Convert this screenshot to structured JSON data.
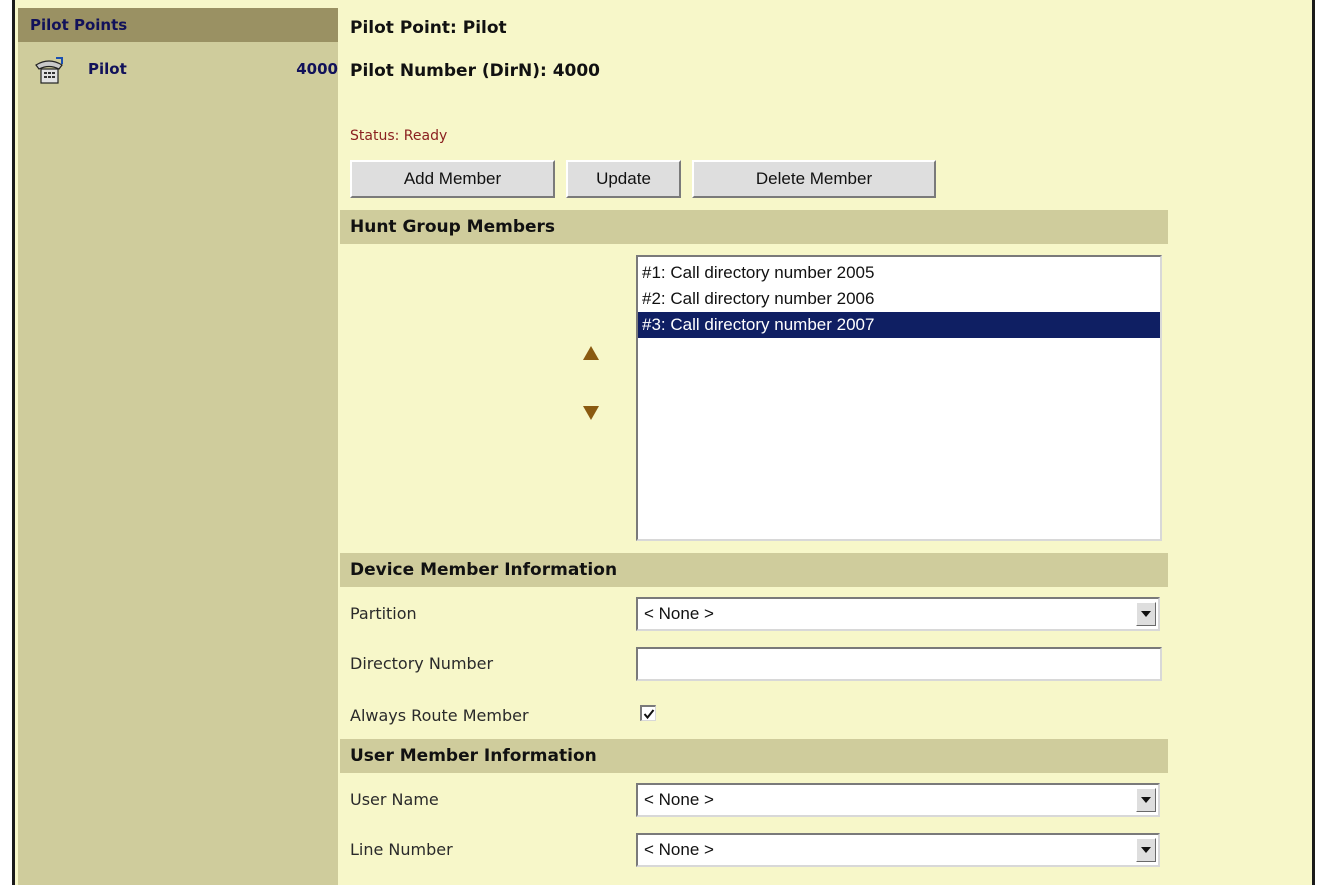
{
  "sidebar": {
    "header": "Pilot Points",
    "items": [
      {
        "label": "Pilot",
        "number": "4000",
        "icon": "phone-icon"
      }
    ]
  },
  "main": {
    "pilot_point": "Pilot Point: Pilot",
    "pilot_number": "Pilot Number (DirN): 4000",
    "status": "Status: Ready",
    "buttons": {
      "add_member": "Add Member",
      "update": "Update",
      "delete_member": "Delete Member"
    },
    "hunt_group": {
      "title": "Hunt Group Members",
      "members": [
        "#1: Call directory number 2005",
        "#2: Call directory number 2006",
        "#3: Call directory number 2007"
      ],
      "selected_index": 2,
      "move_up_icon": "triangle-up-icon",
      "move_down_icon": "triangle-down-icon"
    },
    "device_member": {
      "title": "Device Member Information",
      "partition_label": "Partition",
      "partition_value": "< None >",
      "directory_number_label": "Directory Number",
      "directory_number_value": "",
      "always_route_label": "Always Route Member",
      "always_route_checked": true
    },
    "user_member": {
      "title": "User Member Information",
      "user_name_label": "User Name",
      "user_name_value": "< None >",
      "line_number_label": "Line Number",
      "line_number_value": "< None >"
    }
  },
  "colors": {
    "page_background": "#f7f7c9",
    "sidebar_background": "#cfcc9c",
    "sidebar_header": "#9a9163",
    "section_bar": "#cfcc9c",
    "selected_row": "#0f1f63",
    "arrow_color": "#8a5a10",
    "status_text": "#8a1f1f"
  }
}
